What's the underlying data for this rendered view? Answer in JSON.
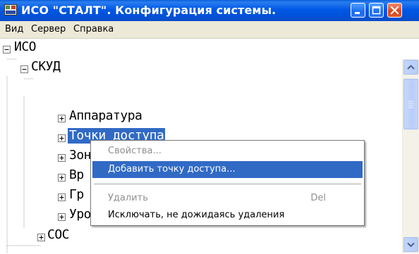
{
  "window": {
    "title": "ИСО \"СТАЛТ\". Конфигурация системы.",
    "icon": "app-icon",
    "controls": [
      "minimize-icon",
      "maximize-icon",
      "close-icon"
    ]
  },
  "menubar": {
    "items": [
      "Вид",
      "Сервер",
      "Справка"
    ]
  },
  "tree": {
    "nodes": [
      {
        "label": "ИСО",
        "expander": "−",
        "level": 0
      },
      {
        "label": "СКУД",
        "expander": "−",
        "level": 1
      },
      {
        "label": "Аппаратура",
        "expander": "+",
        "level": 2
      },
      {
        "label": "Точки доступа",
        "expander": "+",
        "level": 2,
        "selected": true
      },
      {
        "label": "Зоны",
        "expander": "+",
        "level": 2
      },
      {
        "label": "Вр",
        "expander": "+",
        "level": 2
      },
      {
        "label": "Гр",
        "expander": "+",
        "level": 2
      },
      {
        "label": "Уровни доступа",
        "expander": "+",
        "level": 2
      },
      {
        "label": "СОС",
        "expander": "+",
        "level": 1
      }
    ]
  },
  "context_menu": {
    "items": [
      {
        "label": "Свойства...",
        "shortcut": "",
        "state": "disabled"
      },
      {
        "label": "Добавить точку доступа...",
        "shortcut": "",
        "state": "highlighted"
      },
      {
        "label": "Удалить",
        "shortcut": "Del",
        "state": "disabled"
      },
      {
        "label": "Исключать, не дожидаясь удаления",
        "shortcut": "",
        "state": "enabled"
      }
    ]
  },
  "colors": {
    "titlebar": "#0058e6",
    "selection": "#316ac5",
    "menubar": "#ece9d8"
  }
}
